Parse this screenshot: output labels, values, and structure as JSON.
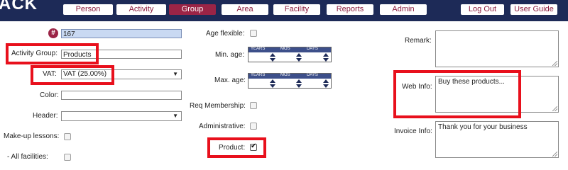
{
  "app": {
    "logo_text": "ACK"
  },
  "nav": {
    "person": "Person",
    "activity": "Activity",
    "group": "Group",
    "area": "Area",
    "facility": "Facility",
    "reports": "Reports",
    "admin": "Admin",
    "logout": "Log Out",
    "user_guide": "User Guide"
  },
  "form": {
    "id_value": "167",
    "activity_group_label": "Activity Group:",
    "activity_group_value": "Products",
    "vat_label": "VAT:",
    "vat_value": "VAT (25.00%)",
    "color_label": "Color:",
    "header_label": "Header:",
    "header_value": "",
    "makeup_label": "Make-up lessons:",
    "all_facilities_label": "- All facilities:",
    "age_flexible_label": "Age flexible:",
    "min_age_label": "Min. age:",
    "max_age_label": "Max. age:",
    "age_headers": {
      "years": "YEARS",
      "mos": "MOS",
      "days": "DAYS"
    },
    "req_membership_label": "Req Membership:",
    "administrative_label": "Administrative:",
    "product_label": "Product:",
    "product_checked": true,
    "remark_label": "Remark:",
    "remark_value": "",
    "web_info_label": "Web Info:",
    "web_info_value": "Buy these products...",
    "invoice_info_label": "Invoice Info:",
    "invoice_info_value": "Thank you for your business"
  },
  "colors": {
    "topbar": "#1d2a57",
    "accent": "#9b2446",
    "highlight": "#e8101c"
  }
}
